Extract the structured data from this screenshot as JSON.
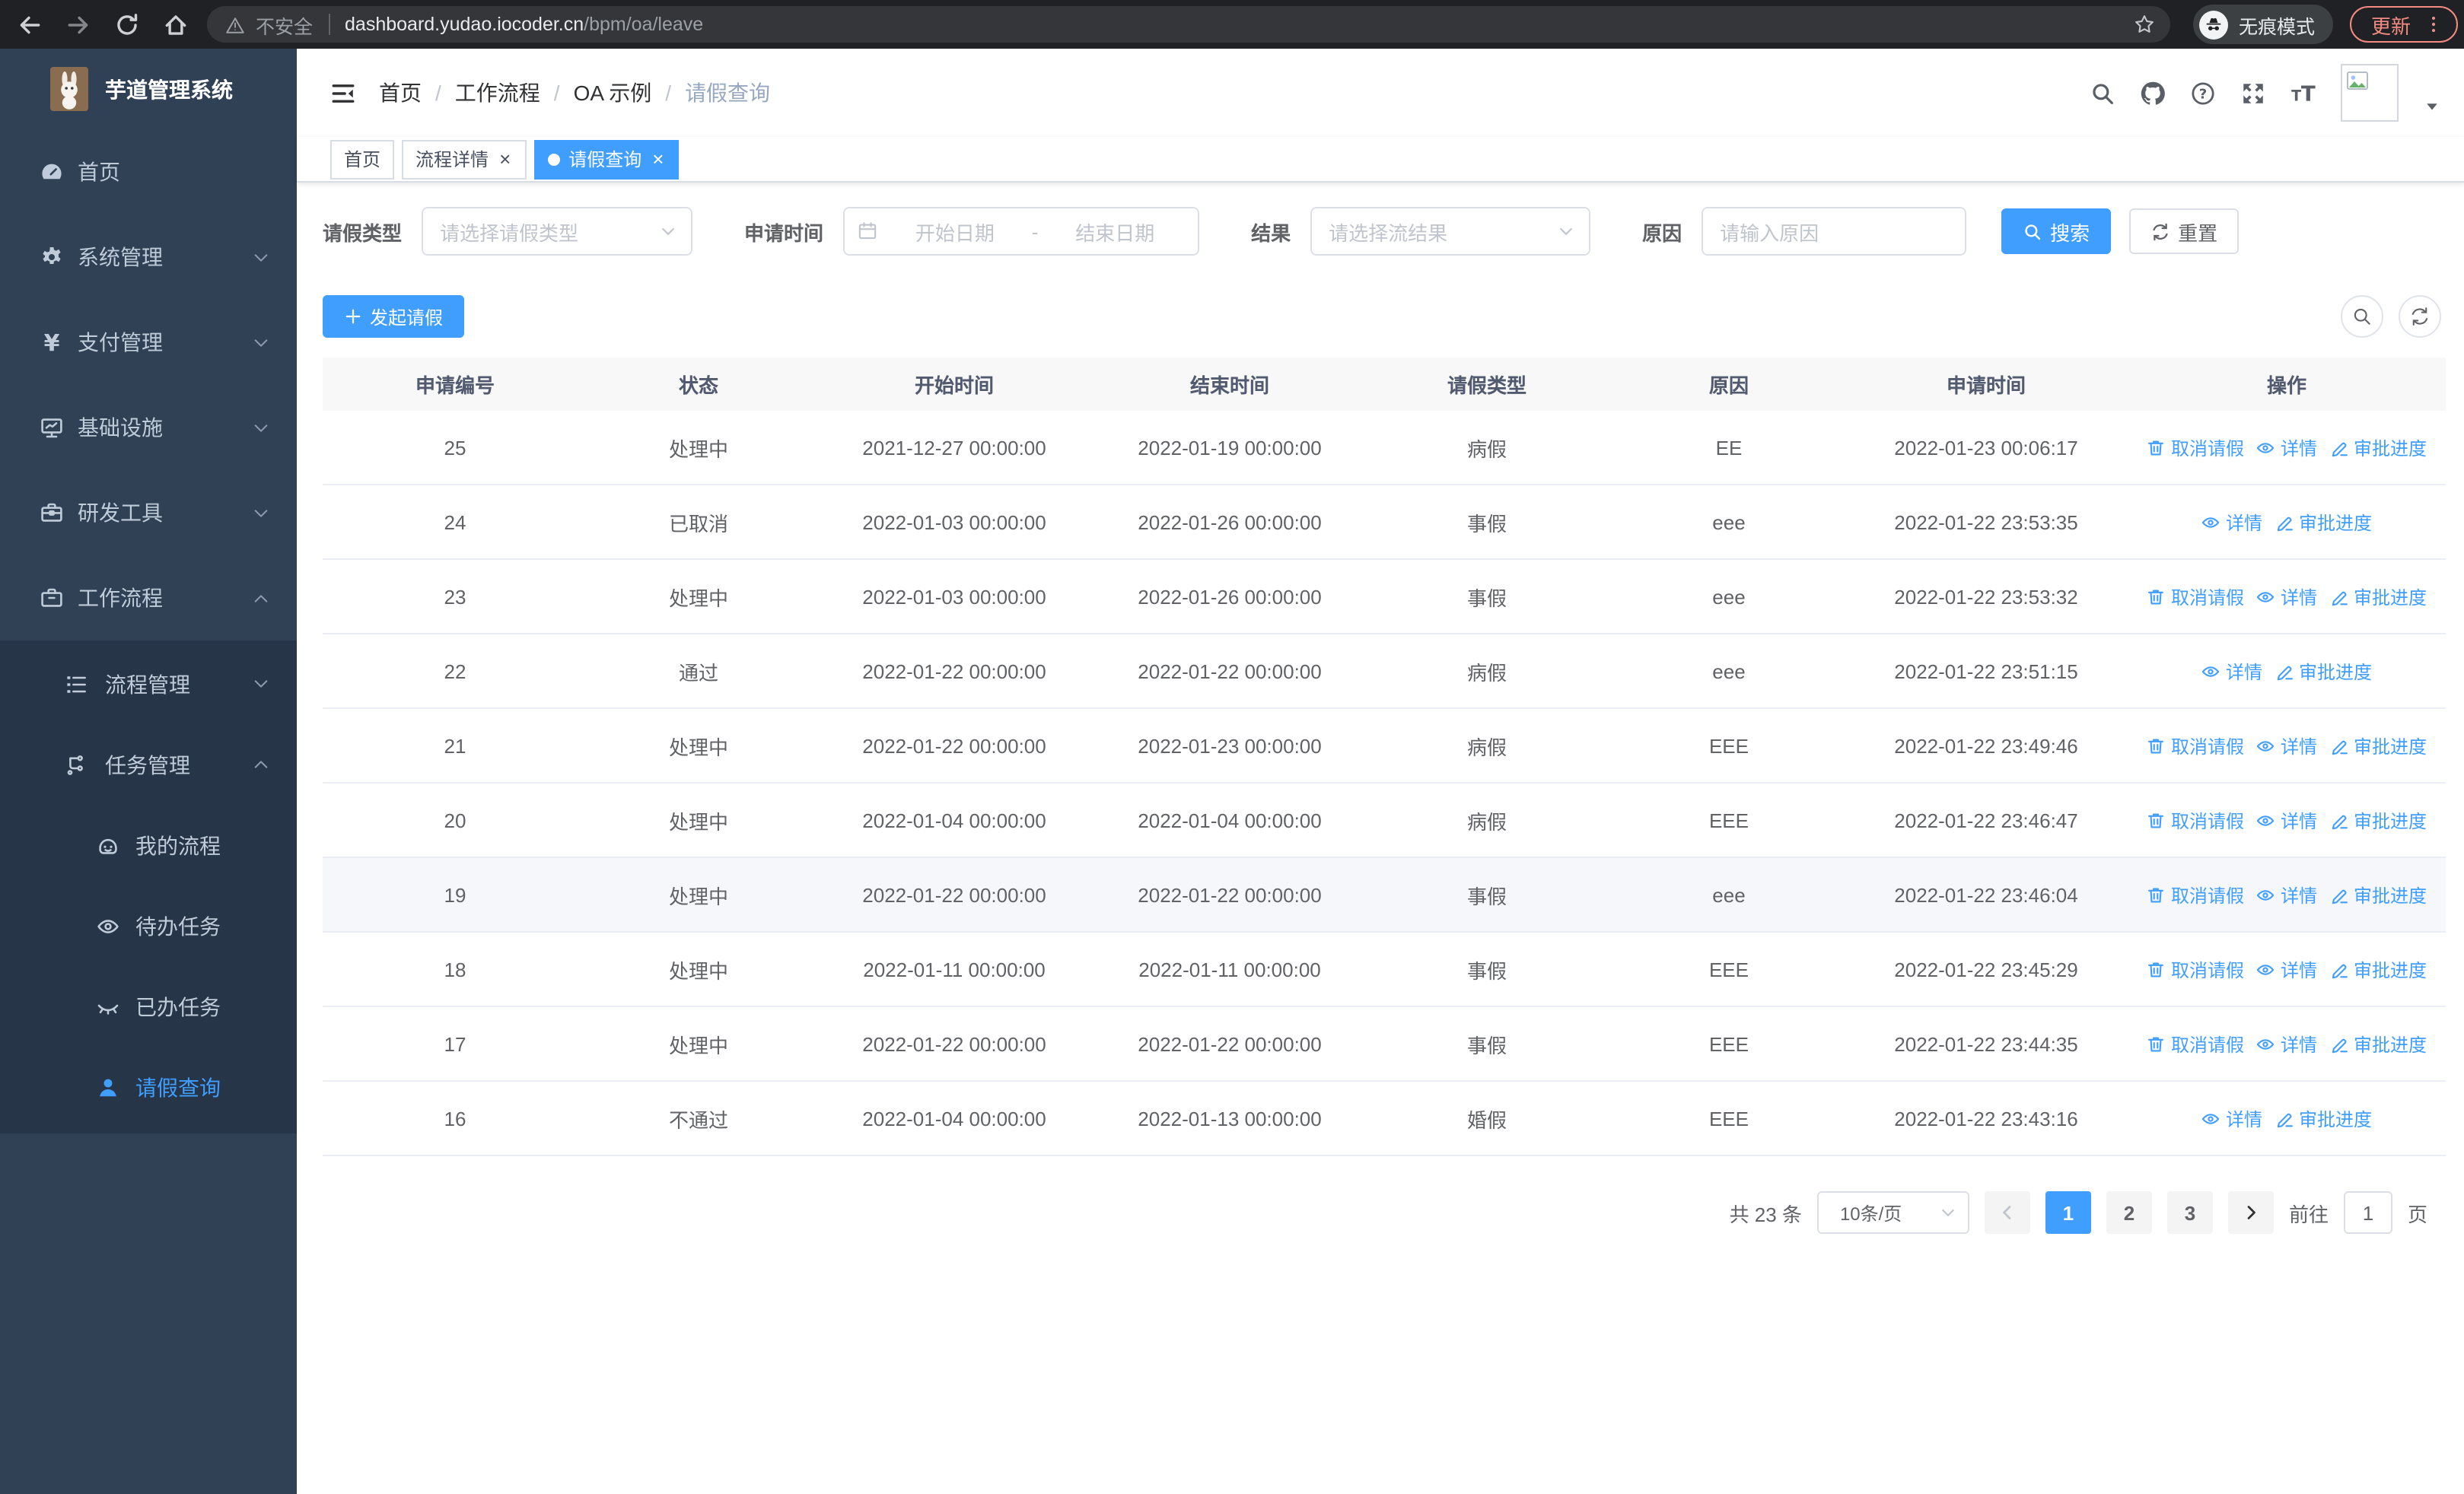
{
  "browser": {
    "security_label": "不安全",
    "url_host": "dashboard.yudao.iocoder.cn",
    "url_path": "/bpm/oa/leave",
    "incognito_label": "无痕模式",
    "update_label": "更新"
  },
  "sidebar": {
    "title": "芋道管理系统",
    "items": [
      {
        "key": "home",
        "label": "首页",
        "icon": "dashboard",
        "level": 1,
        "sub": false,
        "chevron": "",
        "active": false
      },
      {
        "key": "system",
        "label": "系统管理",
        "icon": "gear",
        "level": 1,
        "sub": false,
        "chevron": "down",
        "active": false
      },
      {
        "key": "payment",
        "label": "支付管理",
        "icon": "yen",
        "level": 1,
        "sub": false,
        "chevron": "down",
        "active": false
      },
      {
        "key": "infra",
        "label": "基础设施",
        "icon": "monitor",
        "level": 1,
        "sub": false,
        "chevron": "down",
        "active": false
      },
      {
        "key": "devtools",
        "label": "研发工具",
        "icon": "toolbox",
        "level": 1,
        "sub": false,
        "chevron": "down",
        "active": false
      },
      {
        "key": "workflow",
        "label": "工作流程",
        "icon": "briefcase",
        "level": 1,
        "sub": false,
        "chevron": "up",
        "active": false
      },
      {
        "key": "process-mgmt",
        "label": "流程管理",
        "icon": "listtree",
        "level": 2,
        "sub": true,
        "chevron": "down",
        "active": false
      },
      {
        "key": "task-mgmt",
        "label": "任务管理",
        "icon": "flow",
        "level": 2,
        "sub": true,
        "chevron": "up",
        "active": false
      },
      {
        "key": "my-process",
        "label": "我的流程",
        "icon": "robot",
        "level": 3,
        "sub": true,
        "chevron": "",
        "active": false
      },
      {
        "key": "todo-tasks",
        "label": "待办任务",
        "icon": "eye",
        "level": 3,
        "sub": true,
        "chevron": "",
        "active": false
      },
      {
        "key": "done-tasks",
        "label": "已办任务",
        "icon": "eyeclosed",
        "level": 3,
        "sub": true,
        "chevron": "",
        "active": false
      },
      {
        "key": "leave-query",
        "label": "请假查询",
        "icon": "user",
        "level": 3,
        "sub": true,
        "chevron": "",
        "active": true
      }
    ]
  },
  "breadcrumb": [
    "首页",
    "工作流程",
    "OA 示例",
    "请假查询"
  ],
  "tabs": [
    {
      "key": "home",
      "label": "首页",
      "closable": false,
      "active": false
    },
    {
      "key": "process-detail",
      "label": "流程详情",
      "closable": true,
      "active": false
    },
    {
      "key": "leave-query",
      "label": "请假查询",
      "closable": true,
      "active": true
    }
  ],
  "filters": {
    "leave_type": {
      "label": "请假类型",
      "placeholder": "请选择请假类型"
    },
    "apply_time": {
      "label": "申请时间",
      "start_placeholder": "开始日期",
      "separator": "-",
      "end_placeholder": "结束日期"
    },
    "result": {
      "label": "结果",
      "placeholder": "请选择流结果"
    },
    "reason": {
      "label": "原因",
      "placeholder": "请输入原因"
    },
    "search_label": "搜索",
    "reset_label": "重置"
  },
  "actions_bar": {
    "create_label": "发起请假"
  },
  "table": {
    "headers": [
      "申请编号",
      "状态",
      "开始时间",
      "结束时间",
      "请假类型",
      "原因",
      "申请时间",
      "操作"
    ],
    "action_catalog": {
      "cancel": {
        "label": "取消请假",
        "icon": "trash"
      },
      "detail": {
        "label": "详情",
        "icon": "eyesm"
      },
      "progress": {
        "label": "审批进度",
        "icon": "pen"
      }
    },
    "rows": [
      {
        "id": "25",
        "status": "处理中",
        "start": "2021-12-27 00:00:00",
        "end": "2022-01-19 00:00:00",
        "type": "病假",
        "reason": "EE",
        "apply": "2022-01-23 00:06:17",
        "actions": [
          "cancel",
          "detail",
          "progress"
        ],
        "highlighted": false
      },
      {
        "id": "24",
        "status": "已取消",
        "start": "2022-01-03 00:00:00",
        "end": "2022-01-26 00:00:00",
        "type": "事假",
        "reason": "eee",
        "apply": "2022-01-22 23:53:35",
        "actions": [
          "detail",
          "progress"
        ],
        "highlighted": false
      },
      {
        "id": "23",
        "status": "处理中",
        "start": "2022-01-03 00:00:00",
        "end": "2022-01-26 00:00:00",
        "type": "事假",
        "reason": "eee",
        "apply": "2022-01-22 23:53:32",
        "actions": [
          "cancel",
          "detail",
          "progress"
        ],
        "highlighted": false
      },
      {
        "id": "22",
        "status": "通过",
        "start": "2022-01-22 00:00:00",
        "end": "2022-01-22 00:00:00",
        "type": "病假",
        "reason": "eee",
        "apply": "2022-01-22 23:51:15",
        "actions": [
          "detail",
          "progress"
        ],
        "highlighted": false
      },
      {
        "id": "21",
        "status": "处理中",
        "start": "2022-01-22 00:00:00",
        "end": "2022-01-23 00:00:00",
        "type": "病假",
        "reason": "EEE",
        "apply": "2022-01-22 23:49:46",
        "actions": [
          "cancel",
          "detail",
          "progress"
        ],
        "highlighted": false
      },
      {
        "id": "20",
        "status": "处理中",
        "start": "2022-01-04 00:00:00",
        "end": "2022-01-04 00:00:00",
        "type": "病假",
        "reason": "EEE",
        "apply": "2022-01-22 23:46:47",
        "actions": [
          "cancel",
          "detail",
          "progress"
        ],
        "highlighted": false
      },
      {
        "id": "19",
        "status": "处理中",
        "start": "2022-01-22 00:00:00",
        "end": "2022-01-22 00:00:00",
        "type": "事假",
        "reason": "eee",
        "apply": "2022-01-22 23:46:04",
        "actions": [
          "cancel",
          "detail",
          "progress"
        ],
        "highlighted": true
      },
      {
        "id": "18",
        "status": "处理中",
        "start": "2022-01-11 00:00:00",
        "end": "2022-01-11 00:00:00",
        "type": "事假",
        "reason": "EEE",
        "apply": "2022-01-22 23:45:29",
        "actions": [
          "cancel",
          "detail",
          "progress"
        ],
        "highlighted": false
      },
      {
        "id": "17",
        "status": "处理中",
        "start": "2022-01-22 00:00:00",
        "end": "2022-01-22 00:00:00",
        "type": "事假",
        "reason": "EEE",
        "apply": "2022-01-22 23:44:35",
        "actions": [
          "cancel",
          "detail",
          "progress"
        ],
        "highlighted": false
      },
      {
        "id": "16",
        "status": "不通过",
        "start": "2022-01-04 00:00:00",
        "end": "2022-01-13 00:00:00",
        "type": "婚假",
        "reason": "EEE",
        "apply": "2022-01-22 23:43:16",
        "actions": [
          "detail",
          "progress"
        ],
        "highlighted": false
      }
    ]
  },
  "pagination": {
    "total_label": "共 23 条",
    "page_size": "10条/页",
    "pages": [
      "1",
      "2",
      "3"
    ],
    "active_page": "1",
    "goto_label": "前往",
    "goto_value": "1",
    "page_label": "页"
  },
  "colors": {
    "accent": "#409EFF",
    "sidebar_bg": "#304156",
    "submenu_bg": "#273548",
    "update_accent": "#f28b82",
    "table_header_bg": "#f8f8f9",
    "row_highlight": "#f5f7fa"
  }
}
